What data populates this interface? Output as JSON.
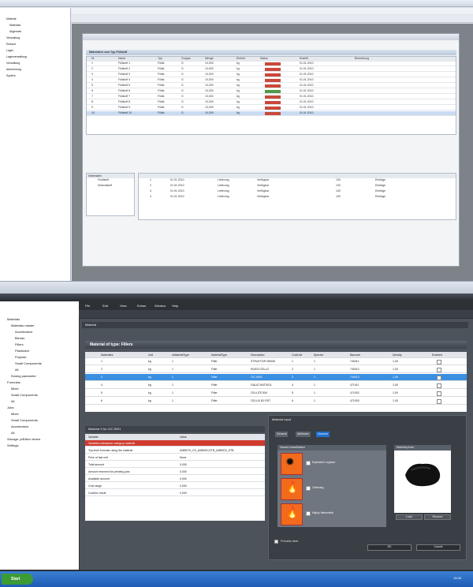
{
  "top": {
    "title": "",
    "tree": [
      {
        "label": "Material",
        "indent": 1
      },
      {
        "label": "Materials",
        "indent": 2
      },
      {
        "label": "Allgemein",
        "indent": 2
      },
      {
        "label": "Verwaltung",
        "indent": 1
      },
      {
        "label": "Einkauf",
        "indent": 1
      },
      {
        "label": "Lager",
        "indent": 1
      },
      {
        "label": "Lagerverwaltung",
        "indent": 1
      },
      {
        "label": "Verwaltung",
        "indent": 1
      },
      {
        "label": "Abrechnung",
        "indent": 1
      },
      {
        "label": "System",
        "indent": 1
      }
    ],
    "panel_title": "Materialien vom Typ Füllstoff",
    "columns": [
      "Nr",
      "Name",
      "Typ",
      "Gruppe",
      "Menge",
      "Einheit",
      "Status",
      "Erstellt",
      "Bemerkung"
    ],
    "rows": [
      [
        "1",
        "Füllstoff 1",
        "Füllst.",
        "G",
        "10,000",
        "kg",
        "",
        "01.01.2010",
        ""
      ],
      [
        "2",
        "Füllstoff 2",
        "Füllst.",
        "G",
        "10,000",
        "kg",
        "",
        "01.01.2010",
        ""
      ],
      [
        "3",
        "Füllstoff 3",
        "Füllst.",
        "G",
        "10,000",
        "kg",
        "",
        "01.01.2010",
        ""
      ],
      [
        "4",
        "Füllstoff 4",
        "Füllst.",
        "G",
        "10,000",
        "kg",
        "",
        "01.01.2010",
        ""
      ],
      [
        "5",
        "Füllstoff 5",
        "Füllst.",
        "G",
        "10,000",
        "kg",
        "",
        "01.01.2010",
        ""
      ],
      [
        "6",
        "Füllstoff 6",
        "Füllst.",
        "G",
        "10,000",
        "kg",
        "",
        "01.01.2010",
        ""
      ],
      [
        "7",
        "Füllstoff 7",
        "Füllst.",
        "G",
        "10,000",
        "kg",
        "",
        "01.01.2010",
        ""
      ],
      [
        "8",
        "Füllstoff 8",
        "Füllst.",
        "G",
        "10,000",
        "kg",
        "",
        "01.01.2010",
        ""
      ],
      [
        "9",
        "Füllstoff 9",
        "Füllst.",
        "G",
        "10,000",
        "kg",
        "",
        "01.01.2010",
        ""
      ],
      [
        "10",
        "Füllstoff 10",
        "Füllst.",
        "G",
        "10,000",
        "kg",
        "",
        "01.01.2010",
        ""
      ]
    ],
    "sub_left_title": "Materialien",
    "sub_left_rows": [
      "Fuellstoff",
      "Mineralstoff"
    ],
    "sub_right_rows": [
      [
        "1",
        "01.01.2010",
        "Lieferung",
        "Verfügbar",
        "100",
        "Einträge"
      ],
      [
        "2",
        "01.01.2010",
        "Lieferung",
        "Verfügbar",
        "100",
        "Einträge"
      ],
      [
        "3",
        "01.01.2010",
        "Lieferung",
        "Verfügbar",
        "100",
        "Einträge"
      ],
      [
        "4",
        "01.01.2010",
        "Lieferung",
        "Verfügbar",
        "100",
        "Einträge"
      ]
    ]
  },
  "bottom": {
    "menu": [
      "File",
      "Edit",
      "View",
      "Extras",
      "Window",
      "Help"
    ],
    "doc_title": "Material",
    "group_title": "Material of type: Fillers",
    "columns": [
      "Materialnr.",
      "Unit",
      "uMaterialType",
      "MaterialType",
      "Description",
      "CostUnit",
      "Species",
      "Barcode",
      "Density",
      "Enabled"
    ],
    "rows": [
      [
        "1",
        "kg",
        "1",
        "Filler",
        "STRUKTOR SB008",
        "1",
        "1",
        "740011",
        "1,00"
      ],
      [
        "2",
        "kg",
        "1",
        "Filler",
        "RUSSI CELLO",
        "2",
        "1",
        "740012",
        "1,00"
      ],
      [
        "3",
        "kg",
        "1",
        "Filler",
        "CIC 5001",
        "3",
        "1",
        "740013",
        "1,00"
      ],
      [
        "4",
        "kg",
        "1",
        "Filler",
        "GALAT ANTISOL",
        "4",
        "1",
        "471011",
        "1,00"
      ],
      [
        "5",
        "kg",
        "1",
        "Filler",
        "CELLITE 500",
        "5",
        "1",
        "471002",
        "1,00"
      ],
      [
        "6",
        "kg",
        "1",
        "Filler",
        "CELLIX B1 RS7",
        "6",
        "1",
        "471003",
        "1,00"
      ]
    ],
    "selected_row": 2,
    "props_title": "Material 9 for CIC 5001",
    "prop_cols": [
      "Variable",
      "Value"
    ],
    "props": [
      [
        "Variables substance category material",
        ""
      ],
      [
        "Top level formular using the material",
        "A085070_CS_A085/D0,STB_A085/D0_STB"
      ],
      [
        "Price of last unit",
        "None"
      ],
      [
        "Total amount",
        "0,000"
      ],
      [
        "Amount reserved for pending jobs",
        "0,000"
      ],
      [
        "Available amount",
        "0,000"
      ],
      [
        "Cost range",
        "0,000"
      ],
      [
        "Cost/Inc result",
        "0,000"
      ]
    ],
    "right_title": "Material input",
    "tabs": [
      "General",
      "Attributes",
      "Hazards"
    ],
    "haz_title": "Hazard classification",
    "hazards": [
      "Explosive/ oxydant",
      "Oxidizing",
      "Highly flammable"
    ],
    "image_title": "Material photo",
    "btn_load": "Load",
    "btn_remove": "Remove",
    "chk1": "Printable label",
    "btn_ok": "OK",
    "btn_cancel": "Cancel",
    "tree": [
      {
        "label": "Materials",
        "indent": 1
      },
      {
        "label": "Materials master",
        "indent": 2
      },
      {
        "label": "Accelerators",
        "indent": 3
      },
      {
        "label": "Blends",
        "indent": 3
      },
      {
        "label": "Fillers",
        "indent": 3
      },
      {
        "label": "Plasticizer",
        "indent": 3
      },
      {
        "label": "Polymer",
        "indent": 3
      },
      {
        "label": "Small Components",
        "indent": 3
      },
      {
        "label": "All",
        "indent": 3
      },
      {
        "label": "Dosing parameter",
        "indent": 2
      },
      {
        "label": "Formulas",
        "indent": 1
      },
      {
        "label": "Mixer",
        "indent": 2
      },
      {
        "label": "Small Components",
        "indent": 2
      },
      {
        "label": "All",
        "indent": 2
      },
      {
        "label": "Jobs",
        "indent": 1
      },
      {
        "label": "Mixer",
        "indent": 2
      },
      {
        "label": "Small Components",
        "indent": 2
      },
      {
        "label": "Accelerators",
        "indent": 2
      },
      {
        "label": "All",
        "indent": 2
      },
      {
        "label": "Storage: ptEditor others",
        "indent": 1
      },
      {
        "label": "Settings",
        "indent": 1
      }
    ],
    "start": "Start",
    "clock": "15:08"
  }
}
